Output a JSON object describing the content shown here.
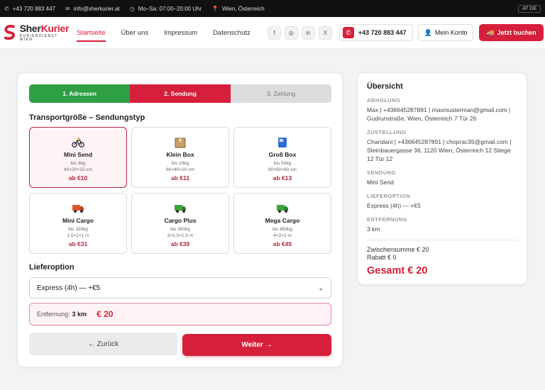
{
  "topbar": {
    "phone": "+43 720 883 447",
    "email": "info@sherkurier.at",
    "hours": "Mo–Sa: 07:00–20:00 Uhr",
    "location": "Wien, Österreich",
    "language": "AT DE"
  },
  "header": {
    "brand_sher": "Sher",
    "brand_kurier": "Kurier",
    "tagline": "KURIERDIENST WIEN",
    "nav": [
      "Startseite",
      "Über uns",
      "Impressum",
      "Datenschutz"
    ],
    "active_nav": "Startseite",
    "socials": [
      "f",
      "◎",
      "in",
      "X"
    ],
    "phone_button": "+43 720 883 447",
    "account_button": "Mein Konto",
    "book_button": "Jetzt buchen"
  },
  "steps": [
    {
      "label": "1. Adressen",
      "state": "done"
    },
    {
      "label": "2. Sendung",
      "state": "current"
    },
    {
      "label": "3. Zahlung",
      "state": "todo"
    }
  ],
  "form": {
    "transport_title": "Transportgröße – Sendungstyp",
    "tiles": [
      {
        "name": "Mini Send",
        "weight": "bis 3kg",
        "dims": "40×20×15 cm",
        "price": "ab €10",
        "icon": "bicycle-icon",
        "selected": true
      },
      {
        "name": "Klein Box",
        "weight": "bis 10kg",
        "dims": "60×40×20 cm",
        "price": "ab €11",
        "icon": "box-icon",
        "selected": false
      },
      {
        "name": "Groß Box",
        "weight": "bis 50kg",
        "dims": "80×60×60 cm",
        "price": "ab €13",
        "icon": "large-box-icon",
        "selected": false
      },
      {
        "name": "Mini Cargo",
        "weight": "bis 150kg",
        "dims": "1.5×1×1 m",
        "price": "ab €31",
        "icon": "van-icon",
        "selected": false
      },
      {
        "name": "Cargo Plus",
        "weight": "bis 300kg",
        "dims": "3×1.5×1.5 m",
        "price": "ab €38",
        "icon": "truck-icon",
        "selected": false
      },
      {
        "name": "Mega Cargo",
        "weight": "bis 850kg",
        "dims": "4×2×2 m",
        "price": "ab €45",
        "icon": "big-truck-icon",
        "selected": false
      }
    ],
    "delivery_title": "Lieferoption",
    "delivery_selected": "Express (4h) — +€5",
    "distance_label": "Entfernung:",
    "distance_value": "3 km",
    "distance_price": "€ 20",
    "back_button": "← Zurück",
    "next_button": "Weiter →"
  },
  "summary": {
    "title": "Übersicht",
    "pickup_label": "ABHOLUNG",
    "pickup_value": "Max | +436645287891 | maxmusterman@gmail.com | Gudrunstraße, Wien, Österreich 7 Tür 26",
    "delivery_label": "ZUSTELLUNG",
    "delivery_value": "Chandani | +436645287891 | choprac35@gmail.com | Steinbauergasse 36, 1120 Wien, Österreich 12 Stiege 12 Tür 12",
    "shipment_label": "SENDUNG",
    "shipment_value": "Mini Send",
    "option_label": "LIEFEROPTION",
    "option_value": "Express (4h) — +€5",
    "distance_label": "ENTFERNUNG",
    "distance_value": "3 km",
    "subtotal": "Zwischensumme € 20",
    "discount": "Rabatt € 0",
    "total": "Gesamt € 20"
  },
  "colors": {
    "accent": "#d61f3a",
    "done": "#2ea043",
    "todo": "#dcdcde"
  }
}
